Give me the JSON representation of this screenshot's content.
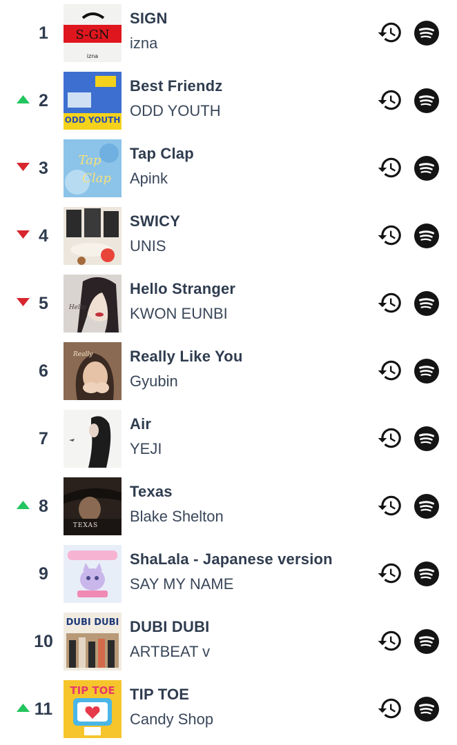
{
  "colors": {
    "rank_text": "#2f3c4f",
    "title_text": "#2f3c4f",
    "artist_text": "#3a475a",
    "trend_up": "#22c55e",
    "trend_down": "#d7262e",
    "icon": "#141414"
  },
  "icons": {
    "history": "history-icon",
    "spotify": "spotify-icon",
    "up": "trend-up-icon",
    "down": "trend-down-icon"
  },
  "tracks": [
    {
      "rank": "1",
      "trend": "none",
      "title": "SIGN",
      "artist": "izna",
      "cover_art": "sign-cover"
    },
    {
      "rank": "2",
      "trend": "up",
      "title": "Best Friendz",
      "artist": "ODD YOUTH",
      "cover_art": "odd-youth-cover"
    },
    {
      "rank": "3",
      "trend": "down",
      "title": "Tap Clap",
      "artist": "Apink",
      "cover_art": "tap-clap-cover"
    },
    {
      "rank": "4",
      "trend": "down",
      "title": "SWICY",
      "artist": "UNIS",
      "cover_art": "swicy-cover"
    },
    {
      "rank": "5",
      "trend": "down",
      "title": "Hello Stranger",
      "artist": "KWON EUNBI",
      "cover_art": "hello-stranger-cover"
    },
    {
      "rank": "6",
      "trend": "none",
      "title": "Really Like You",
      "artist": "Gyubin",
      "cover_art": "really-like-you-cover"
    },
    {
      "rank": "7",
      "trend": "none",
      "title": "Air",
      "artist": "YEJI",
      "cover_art": "air-cover"
    },
    {
      "rank": "8",
      "trend": "up",
      "title": "Texas",
      "artist": "Blake Shelton",
      "cover_art": "texas-cover"
    },
    {
      "rank": "9",
      "trend": "none",
      "title": "ShaLala - Japanese version",
      "artist": "SAY MY NAME",
      "cover_art": "shalala-cover"
    },
    {
      "rank": "10",
      "trend": "none",
      "title": "DUBI DUBI",
      "artist": "ARTBEAT v",
      "cover_art": "dubi-dubi-cover"
    },
    {
      "rank": "11",
      "trend": "up",
      "title": "TIP TOE",
      "artist": "Candy Shop",
      "cover_art": "tip-toe-cover"
    }
  ]
}
